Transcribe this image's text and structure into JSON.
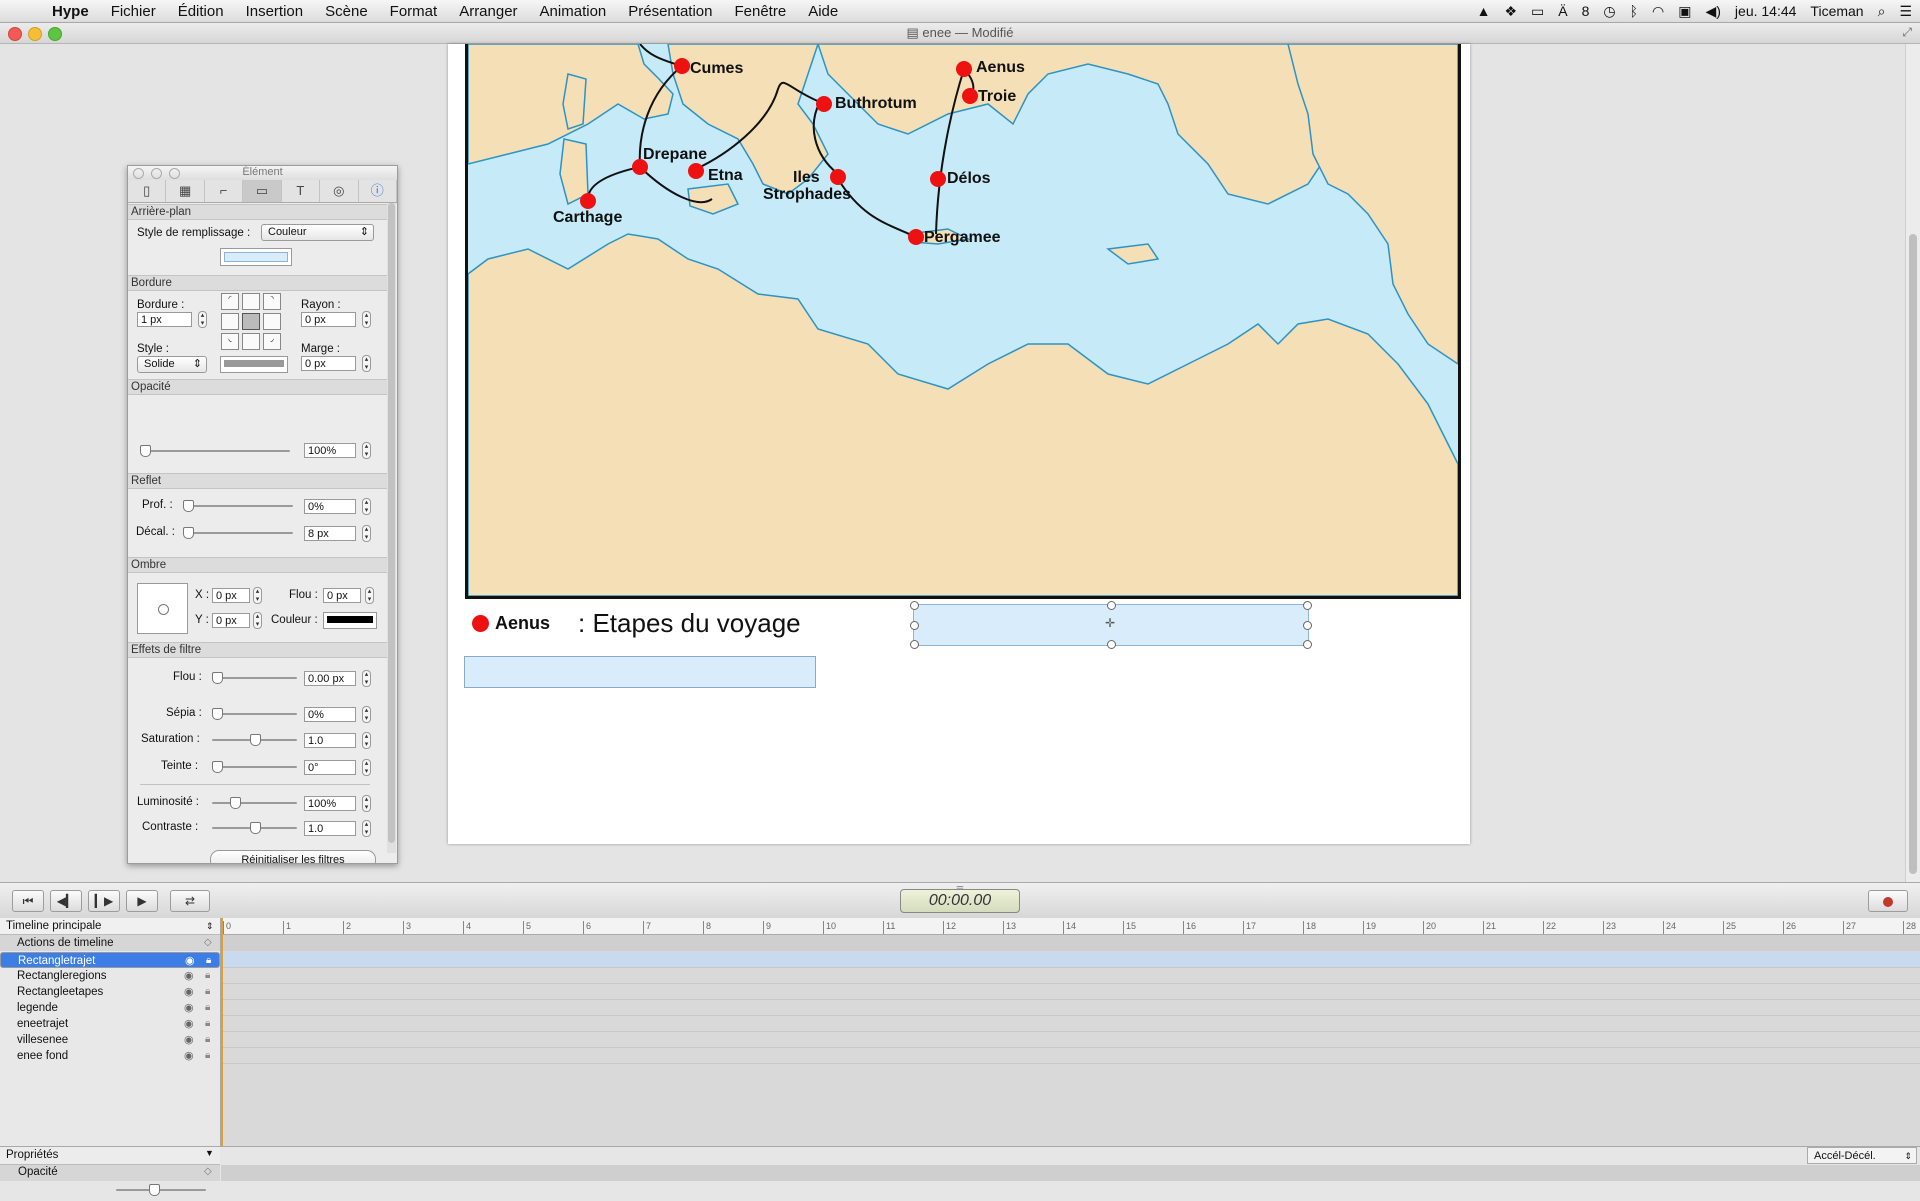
{
  "menubar": {
    "app": "Hype",
    "items": [
      "Fichier",
      "Édition",
      "Insertion",
      "Scène",
      "Format",
      "Arranger",
      "Animation",
      "Présentation",
      "Fenêtre",
      "Aide"
    ],
    "status_badge": "8",
    "clock": "jeu. 14:44",
    "user": "Ticeman"
  },
  "window": {
    "title": "enee — Modifié"
  },
  "map": {
    "cities": [
      {
        "name": "Cumes"
      },
      {
        "name": "Aenus"
      },
      {
        "name": "Troie"
      },
      {
        "name": "Buthrotum"
      },
      {
        "name": "Drepane"
      },
      {
        "name": "Etna"
      },
      {
        "name": "Iles"
      },
      {
        "name": "Strophades"
      },
      {
        "name": "Délos"
      },
      {
        "name": "Carthage"
      },
      {
        "name": "Pergamee"
      }
    ],
    "colors": {
      "sea": "#c6eaf8",
      "land": "#f5dfb6",
      "city": "#ee1111"
    }
  },
  "legend": {
    "marker_label": "Aenus",
    "text": ": Etapes du voyage"
  },
  "inspector": {
    "title": "Élément",
    "tabs": [
      "doc-icon",
      "scene-icon",
      "layout-icon",
      "element-icon",
      "text-icon",
      "action-icon",
      "info-icon"
    ],
    "background": {
      "section": "Arrière-plan",
      "fill_label": "Style de remplissage :",
      "fill_value": "Couleur"
    },
    "border": {
      "section": "Bordure",
      "border_label": "Bordure :",
      "border_value": "1 px",
      "style_label": "Style :",
      "style_value": "Solide",
      "radius_label": "Rayon :",
      "radius_value": "0 px",
      "margin_label": "Marge :",
      "margin_value": "0 px"
    },
    "opacity": {
      "section": "Opacité",
      "value": "100%"
    },
    "reflection": {
      "section": "Reflet",
      "depth_label": "Prof. :",
      "depth_value": "0%",
      "offset_label": "Décal. :",
      "offset_value": "8 px"
    },
    "shadow": {
      "section": "Ombre",
      "x_label": "X :",
      "x_value": "0 px",
      "y_label": "Y :",
      "y_value": "0 px",
      "blur_label": "Flou :",
      "blur_value": "0 px",
      "color_label": "Couleur :"
    },
    "filters": {
      "section": "Effets de filtre",
      "blur_label": "Flou :",
      "blur_value": "0.00 px",
      "sepia_label": "Sépia :",
      "sepia_value": "0%",
      "saturation_label": "Saturation :",
      "saturation_value": "1.0",
      "hue_label": "Teinte :",
      "hue_value": "0°",
      "brightness_label": "Luminosité :",
      "brightness_value": "100%",
      "contrast_label": "Contraste :",
      "contrast_value": "1.0",
      "reset_label": "Réinitialiser les filtres"
    }
  },
  "timeline": {
    "timecode": "00:00.00",
    "selector": "Timeline principale",
    "actions_row": "Actions de timeline",
    "layers": [
      "Rectangletrajet",
      "Rectangleregions",
      "Rectangleetapes",
      "legende",
      "eneetrajet",
      "villesenee",
      "enee fond"
    ],
    "ruler": [
      "0",
      "1",
      "2",
      "3",
      "4",
      "5",
      "6",
      "7",
      "8",
      "9",
      "10",
      "11",
      "12",
      "13",
      "14",
      "15",
      "16",
      "17",
      "18",
      "19",
      "20",
      "21",
      "22",
      "23",
      "24",
      "25",
      "26",
      "27",
      "28"
    ],
    "properties_label": "Propriétés",
    "property_row": "Opacité",
    "easing": "Accél-Décél."
  }
}
